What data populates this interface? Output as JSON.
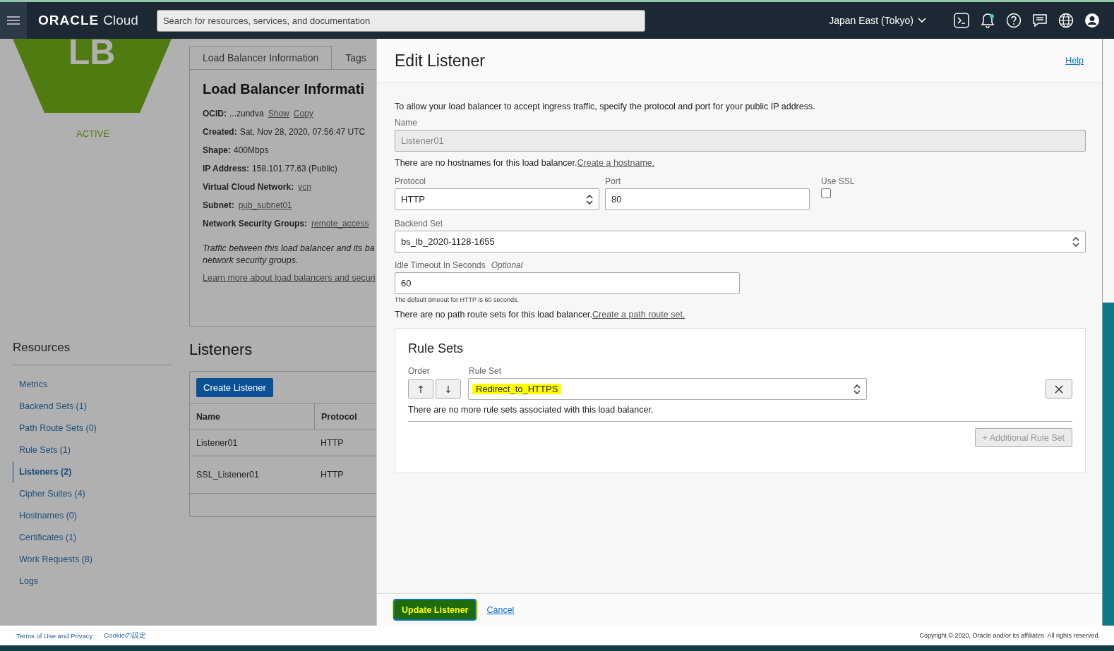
{
  "topbar": {
    "brand": "ORACLE",
    "product": "Cloud",
    "search": {
      "placeholder": "Search for resources, services, and documentation"
    },
    "region": "Japan East (Tokyo)",
    "notification_dot": true
  },
  "resource": {
    "badge": "LB",
    "status": "ACTIVE"
  },
  "info_panel": {
    "tabs": [
      {
        "label": "Load Balancer Information",
        "selected": true
      },
      {
        "label": "Tags",
        "selected": false
      }
    ],
    "title": "Load Balancer Informati",
    "fields": [
      {
        "label": "OCID:",
        "value": "...zundva",
        "links": [
          "Show",
          "Copy"
        ]
      },
      {
        "label": "Created:",
        "value": "Sat, Nov 28, 2020, 07:56:47 UTC"
      },
      {
        "label": "Shape:",
        "value": "400Mbps"
      },
      {
        "label": "IP Address:",
        "value": "158.101.77.63 (Public)"
      },
      {
        "label": "Virtual Cloud Network:",
        "links": [
          "vcn"
        ]
      },
      {
        "label": "Subnet:",
        "links": [
          "pub_subnet01"
        ]
      },
      {
        "label": "Network Security Groups:",
        "links": [
          "remote_access"
        ]
      }
    ],
    "note_lines": [
      "Traffic between this load balancer and its ba",
      "network security groups."
    ],
    "learn_more": "Learn more about load balancers and securi"
  },
  "resources": {
    "title": "Resources",
    "items": [
      {
        "label": "Metrics",
        "selected": false
      },
      {
        "label": "Backend Sets (1)",
        "selected": false
      },
      {
        "label": "Path Route Sets (0)",
        "selected": false
      },
      {
        "label": "Rule Sets (1)",
        "selected": false
      },
      {
        "label": "Listeners (2)",
        "selected": true
      },
      {
        "label": "Cipher Suites (4)",
        "selected": false
      },
      {
        "label": "Hostnames (0)",
        "selected": false
      },
      {
        "label": "Certificates (1)",
        "selected": false
      },
      {
        "label": "Work Requests (8)",
        "selected": false
      },
      {
        "label": "Logs",
        "selected": false
      }
    ]
  },
  "listeners": {
    "title": "Listeners",
    "create_button": "Create Listener",
    "columns": [
      "Name",
      "Protocol"
    ],
    "rows": [
      [
        "Listener01",
        "HTTP"
      ],
      [
        "SSL_Listener01",
        "HTTP"
      ]
    ]
  },
  "drawer": {
    "title": "Edit Listener",
    "help": "Help",
    "intro": "To allow your load balancer to accept ingress traffic, specify the protocol and port for your public IP address.",
    "name": {
      "label": "Name",
      "value": "Listener01",
      "disabled": true
    },
    "hostname_note": "There are no hostnames for this load balancer.",
    "hostname_link": "Create a hostname.",
    "protocol": {
      "label": "Protocol",
      "value": "HTTP"
    },
    "port": {
      "label": "Port",
      "value": "80"
    },
    "use_ssl": {
      "label": "Use SSL",
      "checked": false
    },
    "backend_set": {
      "label": "Backend Set",
      "value": "bs_lb_2020-1128-1655"
    },
    "idle_timeout": {
      "label": "Idle Timeout In Seconds",
      "optional": "Optional",
      "value": "60",
      "hint": "The default timeout for HTTP is 60 seconds."
    },
    "path_note": "There are no path route sets for this load balancer.",
    "path_link": "Create a path route set.",
    "rule_sets": {
      "title": "Rule Sets",
      "order_label": "Order",
      "rule_set_label": "Rule Set",
      "up": "↑",
      "down": "↓",
      "value": "Redirect_to_HTTPS",
      "highlighted": true,
      "note": "There are no more rule sets associated with this load balancer.",
      "add_button": {
        "label": "+ Additional Rule Set",
        "disabled": true
      }
    },
    "submit": {
      "label": "Update Listener",
      "highlighted": true
    },
    "cancel": "Cancel"
  },
  "footer": {
    "links": [
      "Terms of Use and Privacy",
      "Cookieの設定"
    ],
    "copyright": "Copyright © 2020, Oracle and/or its affiliates. All rights reserved."
  }
}
